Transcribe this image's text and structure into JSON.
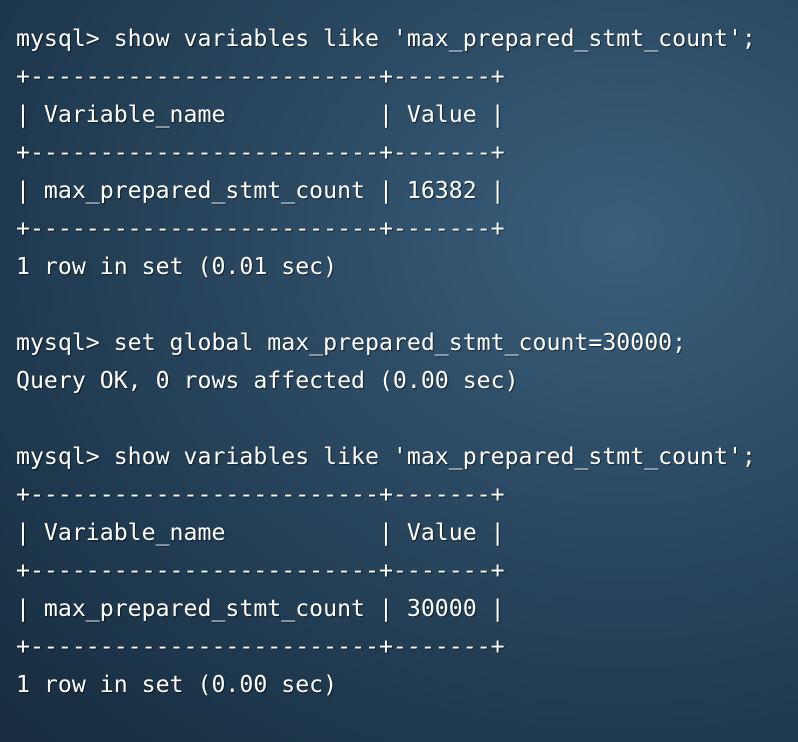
{
  "terminal": {
    "lines": [
      "mysql> show variables like 'max_prepared_stmt_count';",
      "+-------------------------+-------+",
      "| Variable_name           | Value |",
      "+-------------------------+-------+",
      "| max_prepared_stmt_count | 16382 |",
      "+-------------------------+-------+",
      "1 row in set (0.01 sec)",
      "",
      "mysql> set global max_prepared_stmt_count=30000;",
      "Query OK, 0 rows affected (0.00 sec)",
      "",
      "mysql> show variables like 'max_prepared_stmt_count';",
      "+-------------------------+-------+",
      "| Variable_name           | Value |",
      "+-------------------------+-------+",
      "| max_prepared_stmt_count | 30000 |",
      "+-------------------------+-------+",
      "1 row in set (0.00 sec)"
    ]
  }
}
